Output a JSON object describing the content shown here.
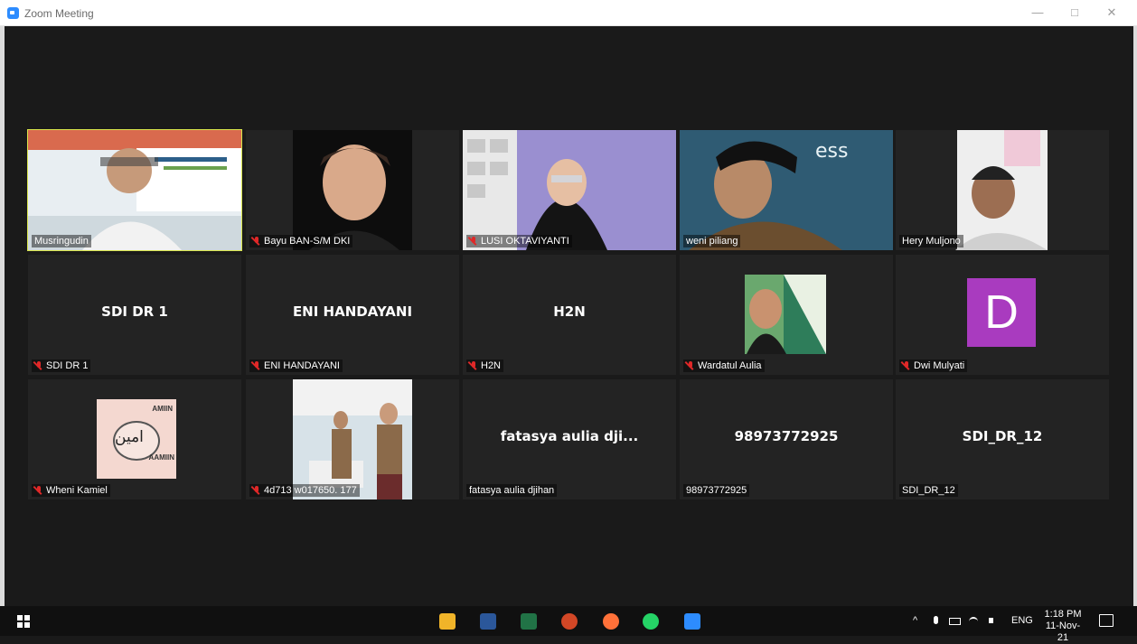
{
  "window": {
    "title": "Zoom Meeting",
    "minimize": "—",
    "maximize": "□",
    "close": "✕"
  },
  "participants": [
    {
      "name": "Musringudin",
      "display": "",
      "muted": false,
      "video": true
    },
    {
      "name": "Bayu BAN-S/M DKI",
      "display": "",
      "muted": true,
      "video": true
    },
    {
      "name": "LUSI OKTAVIYANTI",
      "display": "",
      "muted": true,
      "video": true
    },
    {
      "name": "weni piliang",
      "display": "",
      "muted": false,
      "video": true
    },
    {
      "name": "Hery Muljono",
      "display": "",
      "muted": false,
      "video": true
    },
    {
      "name": "SDI DR 1",
      "display": "SDI DR 1",
      "muted": true,
      "video": false
    },
    {
      "name": "ENI HANDAYANI",
      "display": "ENI HANDAYANI",
      "muted": true,
      "video": false
    },
    {
      "name": "H2N",
      "display": "H2N",
      "muted": true,
      "video": false
    },
    {
      "name": "Wardatul Aulia",
      "display": "",
      "muted": true,
      "video": true
    },
    {
      "name": "Dwi Mulyati",
      "display": "D",
      "muted": true,
      "video": false
    },
    {
      "name": "Wheni Kamiel",
      "display": "",
      "muted": true,
      "video": true
    },
    {
      "name": "4d713 w017650. 177",
      "display": "",
      "muted": true,
      "video": true
    },
    {
      "name": "fatasya aulia djihan",
      "display": "fatasya aulia dji...",
      "muted": false,
      "video": false
    },
    {
      "name": "98973772925",
      "display": "98973772925",
      "muted": false,
      "video": false
    },
    {
      "name": "SDI_DR_12",
      "display": "SDI_DR_12",
      "muted": false,
      "video": false
    }
  ],
  "shared_image_text": {
    "amiin_top": "AMIIN",
    "amiin_arabic": "امين",
    "amiin_bottom": "AAMIIN"
  },
  "taskbar": {
    "tray_lang": "ENG",
    "time": "1:18 PM",
    "date": "11-Nov-21",
    "tray_symbols": "^"
  },
  "colors": {
    "active_speaker": "#d8e44b",
    "avatar_bg": "#a93bbf",
    "mute": "#e02828"
  }
}
